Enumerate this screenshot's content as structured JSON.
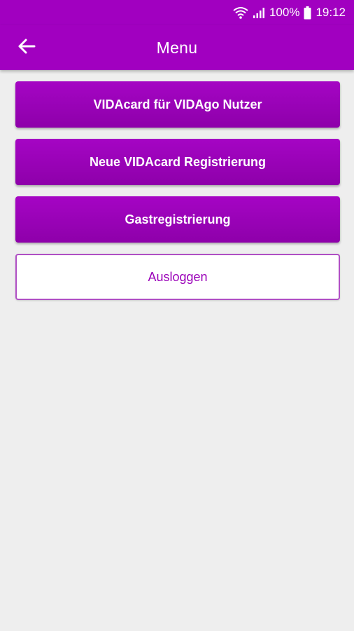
{
  "status_bar": {
    "battery": "100%",
    "time": "19:12",
    "icons": [
      "wifi-icon",
      "signal-icon",
      "battery-icon"
    ]
  },
  "app_bar": {
    "title": "Menu",
    "back_icon": "arrow-left-icon"
  },
  "menu": {
    "items": [
      {
        "label": "VIDAcard für VIDAgo Nutzer",
        "style": "primary"
      },
      {
        "label": "Neue VIDAcard Registrierung",
        "style": "primary"
      },
      {
        "label": "Gastregistrierung",
        "style": "primary"
      },
      {
        "label": "Ausloggen",
        "style": "outline"
      }
    ]
  },
  "colors": {
    "primary": "#a100c0",
    "button_text": "#ffffff",
    "logout_text": "#9a00b8",
    "background": "#eeeeee"
  }
}
